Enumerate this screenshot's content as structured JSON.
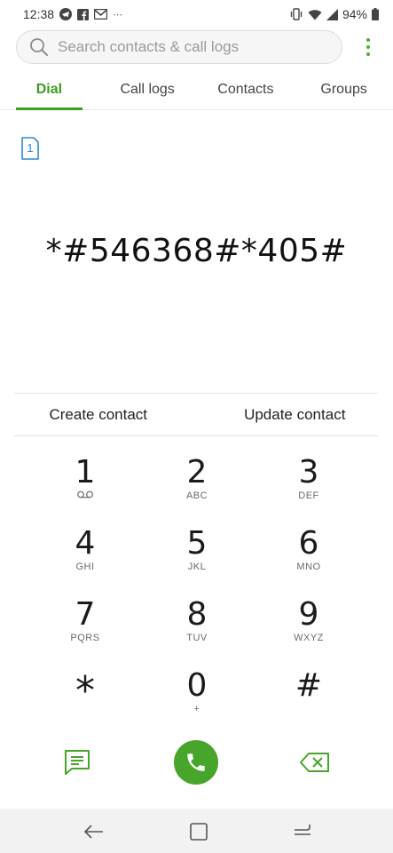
{
  "status_bar": {
    "time": "12:38",
    "battery": "94%",
    "icons_left": [
      "telegram-icon",
      "facebook-icon",
      "gmail-icon",
      "more-notifications-icon"
    ],
    "icons_right": [
      "vibrate-icon",
      "wifi-icon",
      "signal-icon",
      "battery-icon"
    ]
  },
  "search": {
    "placeholder": "Search contacts & call logs"
  },
  "tabs": [
    {
      "label": "Dial",
      "active": true
    },
    {
      "label": "Call logs",
      "active": false
    },
    {
      "label": "Contacts",
      "active": false
    },
    {
      "label": "Groups",
      "active": false
    }
  ],
  "sim": {
    "label": "1"
  },
  "dialed_number": "*#546368#*405#",
  "contact_actions": {
    "create": "Create contact",
    "update": "Update contact"
  },
  "keypad": [
    {
      "digit": "1",
      "letters": ""
    },
    {
      "digit": "2",
      "letters": "ABC"
    },
    {
      "digit": "3",
      "letters": "DEF"
    },
    {
      "digit": "4",
      "letters": "GHI"
    },
    {
      "digit": "5",
      "letters": "JKL"
    },
    {
      "digit": "6",
      "letters": "MNO"
    },
    {
      "digit": "7",
      "letters": "PQRS"
    },
    {
      "digit": "8",
      "letters": "TUV"
    },
    {
      "digit": "9",
      "letters": "WXYZ"
    },
    {
      "digit": "*",
      "letters": ""
    },
    {
      "digit": "0",
      "letters": "+"
    },
    {
      "digit": "#",
      "letters": ""
    }
  ],
  "colors": {
    "accent": "#3e9c1f",
    "call_button": "#47a52b",
    "sim_icon": "#2b8ad8"
  }
}
